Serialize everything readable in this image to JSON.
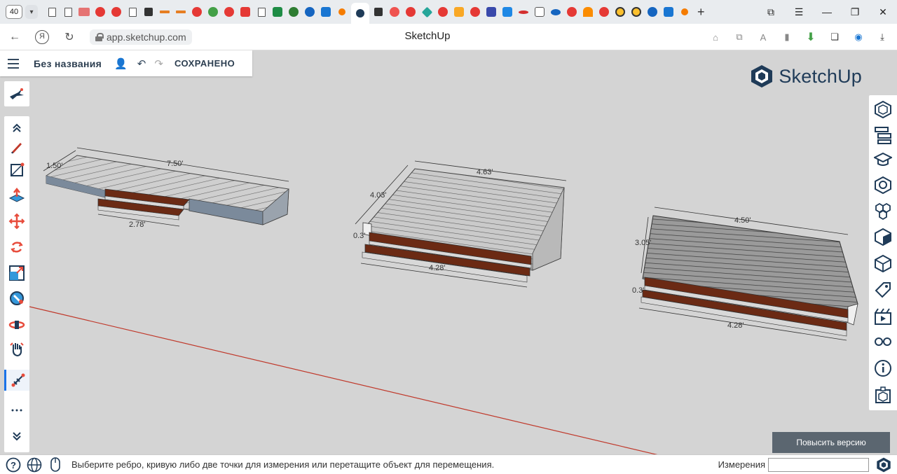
{
  "browser": {
    "tab_count": "40",
    "url": "app.sketchup.com",
    "page_title": "SketchUp"
  },
  "app": {
    "doc_title": "Без названия",
    "saved_status": "СОХРАНЕНО",
    "logo_text": "SketchUp",
    "upgrade_label": "Повысить версию",
    "accent": "#1a73e8",
    "brand": "#1f3b58",
    "axis_red": "#c0392b"
  },
  "left_toolbar": [
    "collapse-up-icon",
    "pencil-icon",
    "rectangle-icon",
    "push-pull-icon",
    "move-icon",
    "rotate-icon",
    "scale-icon",
    "paint-bucket-icon",
    "orbit-icon",
    "pan-icon",
    "tape-measure-icon",
    "more-icon",
    "expand-down-icon"
  ],
  "right_toolbar": [
    "entity-info-icon",
    "outliner-icon",
    "instructor-icon",
    "components-icon",
    "materials-icon",
    "styles-icon",
    "3d-warehouse-icon",
    "tags-icon",
    "scenes-icon",
    "display-icon",
    "info-icon",
    "solid-inspector-icon"
  ],
  "models": {
    "model1": {
      "top_length": "7.50'",
      "depth": "1.50'",
      "step_width": "2.78'"
    },
    "model2": {
      "top_length": "4.63'",
      "depth": "4.03'",
      "side": "0.3'",
      "bottom_length": "4.28'"
    },
    "model3": {
      "top_length": "4.50'",
      "depth": "3.05'",
      "side": "0.3'",
      "bottom_length": "4.28'"
    }
  },
  "statusbar": {
    "message": "Выберите ребро, кривую либо две точки для измерения или перетащите объект для перемещения.",
    "measurements_label": "Измерения",
    "measurements_value": ""
  }
}
